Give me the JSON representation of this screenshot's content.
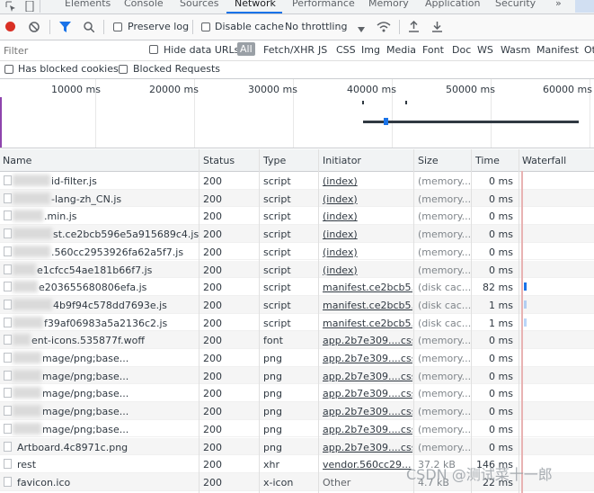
{
  "tabs": [
    "Elements",
    "Console",
    "Sources",
    "Network",
    "Performance",
    "Memory",
    "Application",
    "Security",
    "»"
  ],
  "toolbar": {
    "preserve_log": "Preserve log",
    "disable_cache": "Disable cache",
    "throttling": "No throttling"
  },
  "filter": {
    "placeholder": "Filter",
    "hide_data_urls": "Hide data URLs",
    "all": "All",
    "types": [
      "Fetch/XHR",
      "JS",
      "CSS",
      "Img",
      "Media",
      "Font",
      "Doc",
      "WS",
      "Wasm",
      "Manifest",
      "Ot"
    ],
    "has_blocked_cookies": "Has blocked cookies",
    "blocked_requests": "Blocked Requests"
  },
  "overview": {
    "ticks": [
      "10000 ms",
      "20000 ms",
      "30000 ms",
      "40000 ms",
      "50000 ms",
      "60000 ms"
    ]
  },
  "table": {
    "headers": [
      "Name",
      "Status",
      "Type",
      "Initiator",
      "Size",
      "Time",
      "Waterfall"
    ],
    "rows": [
      {
        "name": "id-filter.js",
        "status": "200",
        "type": "script",
        "initiator": "(index)",
        "size": "(memory...",
        "time": "0 ms",
        "wf": 0.0
      },
      {
        "name": "-lang-zh_CN.js",
        "status": "200",
        "type": "script",
        "initiator": "(index)",
        "size": "(memory...",
        "time": "0 ms",
        "wf": 0.0
      },
      {
        "name": ".min.js",
        "status": "200",
        "type": "script",
        "initiator": "(index)",
        "size": "(memory...",
        "time": "0 ms",
        "wf": 0.0
      },
      {
        "name": "st.ce2bcb596e5a915689c4.js",
        "status": "200",
        "type": "script",
        "initiator": "(index)",
        "size": "(memory...",
        "time": "0 ms",
        "wf": 0.0
      },
      {
        "name": ".560cc2953926fa62a5f7.js",
        "status": "200",
        "type": "script",
        "initiator": "(index)",
        "size": "(memory...",
        "time": "0 ms",
        "wf": 0.0
      },
      {
        "name": "e1cfcc54ae181b66f7.js",
        "status": "200",
        "type": "script",
        "initiator": "(index)",
        "size": "(memory...",
        "time": "0 ms",
        "wf": 0.0
      },
      {
        "name": "e203655680806efa.js",
        "status": "200",
        "type": "script",
        "initiator": "manifest.ce2bcb5...",
        "size": "(disk cac...",
        "time": "82 ms",
        "wf": 1.0
      },
      {
        "name": "4b9f94c578dd7693e.js",
        "status": "200",
        "type": "script",
        "initiator": "manifest.ce2bcb5...",
        "size": "(disk cac...",
        "time": "1 ms",
        "wf": 0.3
      },
      {
        "name": "f39af06983a5a2136c2.js",
        "status": "200",
        "type": "script",
        "initiator": "manifest.ce2bcb5...",
        "size": "(disk cac...",
        "time": "1 ms",
        "wf": 0.3
      },
      {
        "name": "ent-icons.535877f.woff",
        "status": "200",
        "type": "font",
        "initiator": "app.2b7e309....css",
        "size": "(memory...",
        "time": "0 ms",
        "wf": 0.0
      },
      {
        "name": "mage/png;base...",
        "status": "200",
        "type": "png",
        "initiator": "app.2b7e309....css",
        "size": "(memory...",
        "time": "0 ms",
        "wf": 0.0
      },
      {
        "name": "mage/png;base...",
        "status": "200",
        "type": "png",
        "initiator": "app.2b7e309....css",
        "size": "(memory...",
        "time": "0 ms",
        "wf": 0.0
      },
      {
        "name": "mage/png;base...",
        "status": "200",
        "type": "png",
        "initiator": "app.2b7e309....css",
        "size": "(memory...",
        "time": "0 ms",
        "wf": 0.0
      },
      {
        "name": "mage/png;base...",
        "status": "200",
        "type": "png",
        "initiator": "app.2b7e309....css",
        "size": "(memory...",
        "time": "0 ms",
        "wf": 0.0
      },
      {
        "name": "mage/png;base...",
        "status": "200",
        "type": "png",
        "initiator": "app.2b7e309....css",
        "size": "(memory...",
        "time": "0 ms",
        "wf": 0.0
      },
      {
        "name": "Artboard.4c8971c.png",
        "status": "200",
        "type": "png",
        "initiator": "app.2b7e309....css",
        "size": "(memory...",
        "time": "0 ms",
        "wf": 0.0
      },
      {
        "name": "rest",
        "status": "200",
        "type": "xhr",
        "initiator": "vendor.560cc29...",
        "size": "37.2 kB",
        "time": "146 ms",
        "wf": 0.0
      },
      {
        "name": "favicon.ico",
        "status": "200",
        "type": "x-icon",
        "initiator": "Other",
        "size": "4.7 kB",
        "time": "22 ms",
        "wf": 0.0
      }
    ]
  },
  "watermark": "CSDN @测试菜十一郎",
  "colors": {
    "accent": "#1a73e8",
    "record": "#d93025"
  }
}
